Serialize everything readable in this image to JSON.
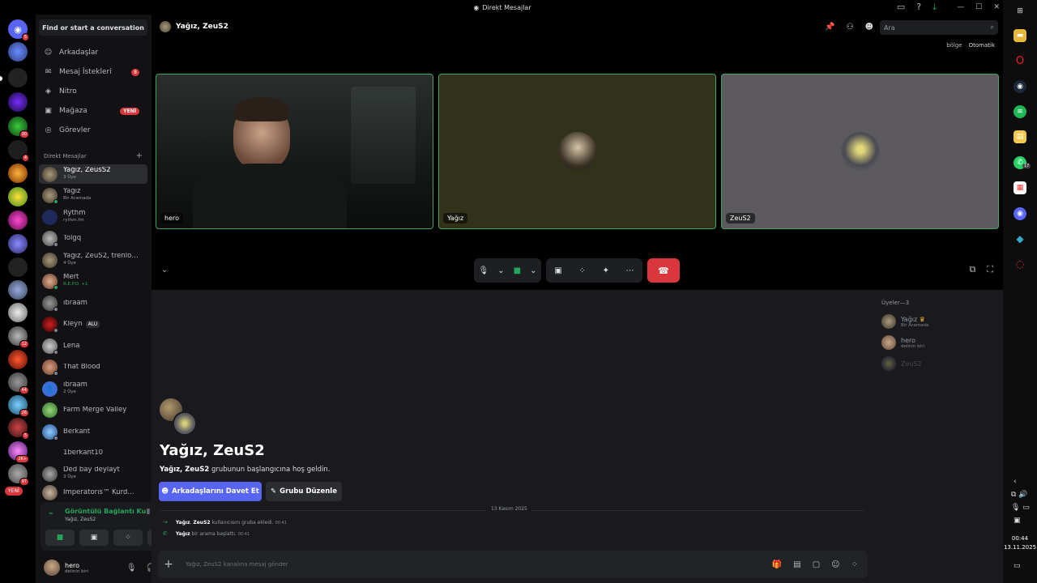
{
  "window": {
    "title": "Direkt Mesajlar"
  },
  "rail": {
    "badges": [
      "5",
      "30",
      "4",
      "12",
      "44",
      "26",
      "5",
      "2K+",
      "97"
    ],
    "new_label": "YENİ"
  },
  "sidebar": {
    "find_label": "Find or start a conversation",
    "nav": [
      {
        "label": "Arkadaşlar",
        "icon": "friends-icon"
      },
      {
        "label": "Mesaj İstekleri",
        "icon": "mail-icon",
        "count": "8"
      },
      {
        "label": "Nitro",
        "icon": "nitro-icon"
      },
      {
        "label": "Mağaza",
        "icon": "shop-icon",
        "badge": "YENİ"
      },
      {
        "label": "Görevler",
        "icon": "quests-icon"
      }
    ],
    "dm_header": "Direkt Mesajlar",
    "dms": [
      {
        "name": "Yağız, ZeusS2",
        "sub": "3 Üye"
      },
      {
        "name": "Yağız",
        "sub": "Bir Aramada"
      },
      {
        "name": "Rythm",
        "sub": "rythm.fm"
      },
      {
        "name": "Tolgq",
        "sub": ""
      },
      {
        "name": "Yağız, ZeuS2, trenlov...",
        "sub": "4 Üye"
      },
      {
        "name": "Mert",
        "sub": "R.E.P.O. +1"
      },
      {
        "name": "ibraam",
        "sub": ""
      },
      {
        "name": "Kleyn",
        "sub": "",
        "tag": "ALU"
      },
      {
        "name": "Lena",
        "sub": ""
      },
      {
        "name": "That Blood",
        "sub": ""
      },
      {
        "name": "ibraam",
        "sub": "2 Üye"
      },
      {
        "name": "Farm Merge Valley",
        "sub": ""
      },
      {
        "name": "Berkant",
        "sub": ""
      },
      {
        "name": "1berkant10",
        "sub": ""
      },
      {
        "name": "Ded bay deylayt",
        "sub": "3 Üye"
      },
      {
        "name": "Imperatoris™ Kurd...",
        "sub": ""
      }
    ],
    "voice": {
      "title": "Görüntülü Bağlantı Ku",
      "channel": "Yağız, ZeuS2"
    },
    "user": {
      "name": "hero",
      "status": "delinin biri"
    }
  },
  "call": {
    "title": "Yağız, ZeuS2",
    "search_placeholder": "Ara",
    "region_label": "bölge",
    "region_value": "Otomatik",
    "tiles": [
      {
        "name": "hero"
      },
      {
        "name": "Yağız"
      },
      {
        "name": "ZeuS2"
      }
    ]
  },
  "chat": {
    "title": "Yağız, ZeuS2",
    "welcome_bold": "Yağız, ZeuS2",
    "welcome_rest": " grubunun başlangıcına hoş geldin.",
    "invite_label": "Arkadaşlarını Davet Et",
    "edit_label": "Grubu Düzenle",
    "date": "13 Kasım 2025",
    "system_messages": [
      {
        "actor": "Yağız",
        "target": "ZeuS2",
        "text": " kullanıcısını gruba ekledi.",
        "time": "00:41"
      },
      {
        "actor": "Yağız",
        "target": "",
        "text": " bir arama başlattı.",
        "time": "00:41"
      }
    ],
    "composer_placeholder": "Yağız, ZeuS2 kanalına mesaj gönder"
  },
  "members": {
    "header": "Üyeler—3",
    "list": [
      {
        "name": "Yağız",
        "sub": "Bir Aramada"
      },
      {
        "name": "hero",
        "sub": "delinin biri"
      },
      {
        "name": "ZeuS2",
        "sub": ""
      }
    ]
  },
  "taskbar": {
    "time": "00:44",
    "date": "13.11.2025",
    "whatsapp_badge": "17"
  }
}
